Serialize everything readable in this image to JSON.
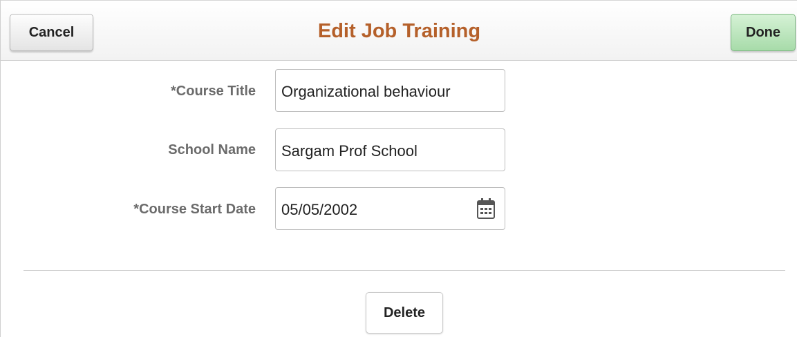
{
  "header": {
    "title": "Edit Job Training",
    "cancel_label": "Cancel",
    "done_label": "Done"
  },
  "form": {
    "fields": [
      {
        "label": "*Course Title",
        "value": "Organizational behaviour"
      },
      {
        "label": "School Name",
        "value": "Sargam Prof School"
      },
      {
        "label": "*Course Start Date",
        "value": "05/05/2002",
        "icon": "calendar-icon"
      }
    ]
  },
  "footer": {
    "delete_label": "Delete"
  },
  "colors": {
    "title": "#b5602a",
    "done_button": "#a7dba9",
    "label": "#6b6b6b"
  }
}
